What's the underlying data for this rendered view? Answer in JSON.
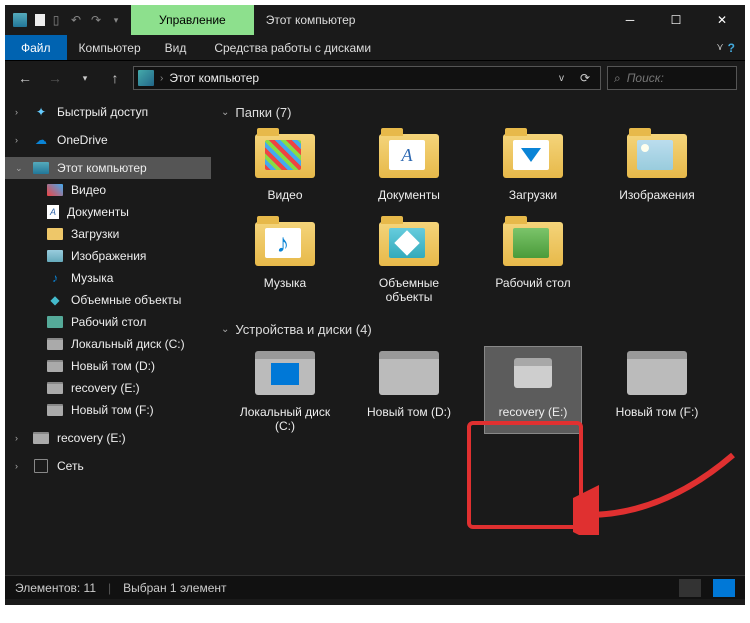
{
  "title": "Этот компьютер",
  "ribbon": {
    "manage": "Управление",
    "file": "Файл",
    "tabs": [
      "Компьютер",
      "Вид"
    ],
    "tools_tab": "Средства работы с дисками"
  },
  "nav": {
    "address": "Этот компьютер",
    "search_placeholder": "Поиск:"
  },
  "sidebar": {
    "quick": "Быстрый доступ",
    "onedrive": "OneDrive",
    "thispc": "Этот компьютер",
    "items": [
      {
        "label": "Видео"
      },
      {
        "label": "Документы"
      },
      {
        "label": "Загрузки"
      },
      {
        "label": "Изображения"
      },
      {
        "label": "Музыка"
      },
      {
        "label": "Объемные объекты"
      },
      {
        "label": "Рабочий стол"
      },
      {
        "label": "Локальный диск (C:)"
      },
      {
        "label": "Новый том (D:)"
      },
      {
        "label": "recovery (E:)"
      },
      {
        "label": "Новый том (F:)"
      }
    ],
    "recovery2": "recovery (E:)",
    "network": "Сеть"
  },
  "groups": {
    "folders_header": "Папки (7)",
    "drives_header": "Устройства и диски (4)"
  },
  "folders": [
    {
      "label": "Видео",
      "kind": "video"
    },
    {
      "label": "Документы",
      "kind": "doc"
    },
    {
      "label": "Загрузки",
      "kind": "dl"
    },
    {
      "label": "Изображения",
      "kind": "img"
    },
    {
      "label": "Музыка",
      "kind": "music"
    },
    {
      "label": "Объемные объекты",
      "kind": "3d"
    },
    {
      "label": "Рабочий стол",
      "kind": "desktop"
    }
  ],
  "drives": [
    {
      "label": "Локальный диск (C:)",
      "kind": "win"
    },
    {
      "label": "Новый том (D:)",
      "kind": "plain"
    },
    {
      "label": "recovery (E:)",
      "kind": "plain",
      "selected": true
    },
    {
      "label": "Новый том (F:)",
      "kind": "plain"
    }
  ],
  "status": {
    "count": "Элементов: 11",
    "selection": "Выбран 1 элемент"
  }
}
